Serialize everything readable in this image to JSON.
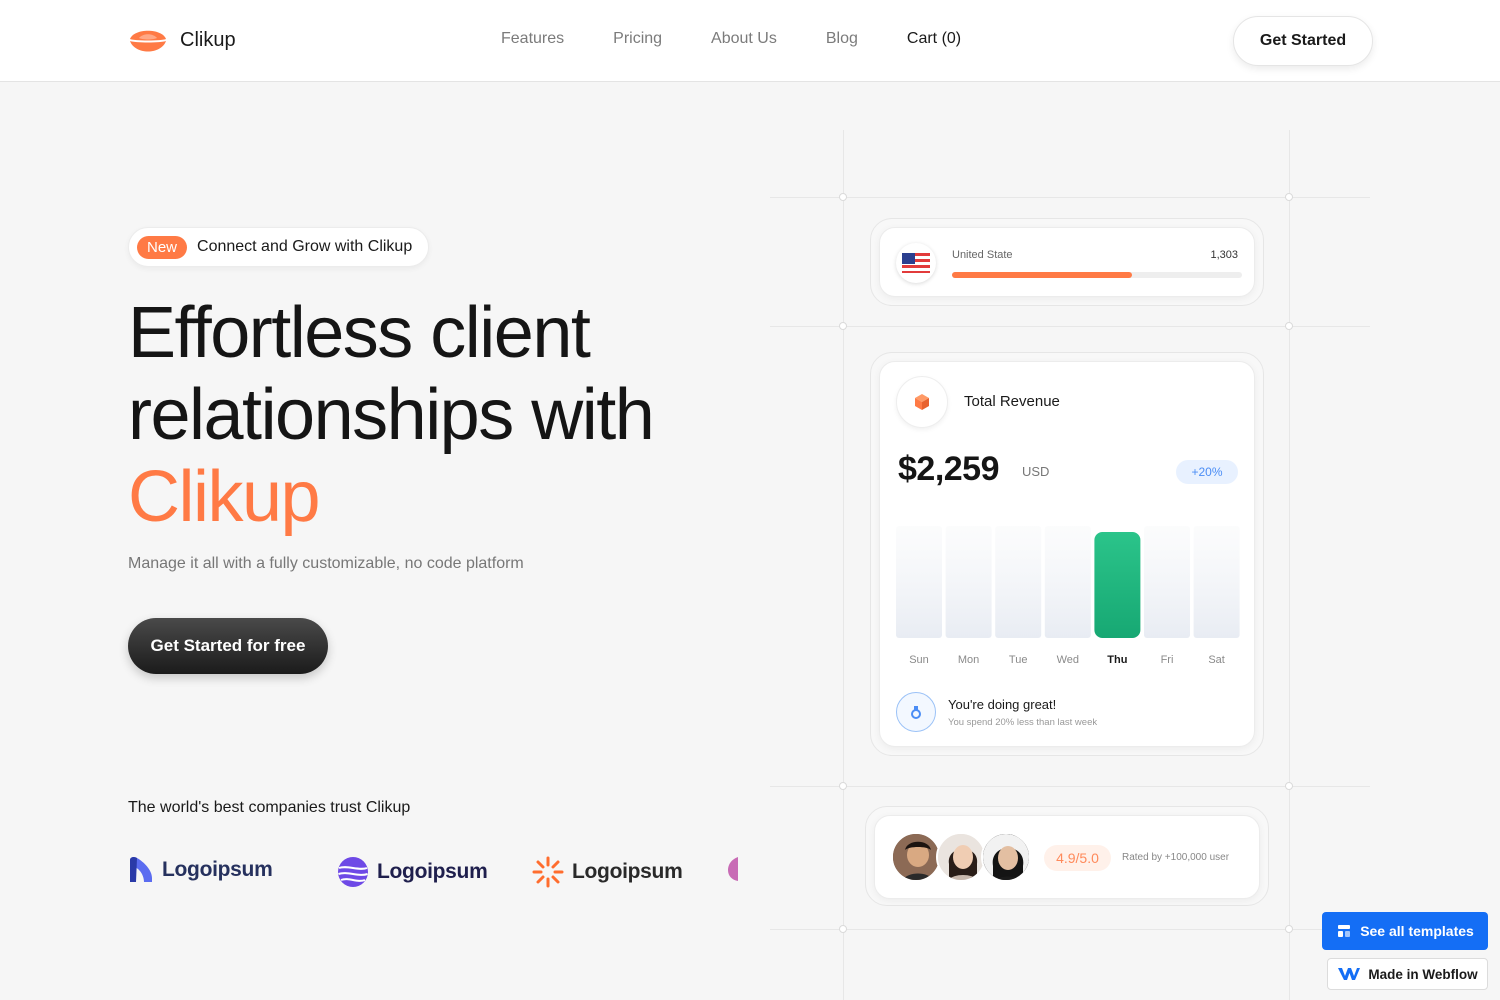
{
  "nav": {
    "brand": "Clikup",
    "links": [
      "Features",
      "Pricing",
      "About Us",
      "Blog"
    ],
    "cart": "Cart (0)",
    "cta": "Get Started",
    "colors": {
      "accent": "#ff7a45"
    }
  },
  "hero": {
    "badge_new": "New",
    "badge_text": "Connect and Grow with Clikup",
    "title_line1": "Effortless client",
    "title_line2": "relationships with",
    "title_accent": "Clikup",
    "subtitle": "Manage it all with a fully customizable, no code platform",
    "cta": "Get Started for free",
    "trust_text": "The world's best companies trust Clikup",
    "logos": [
      "Logoipsum",
      "Logoipsum",
      "Logoipsum"
    ]
  },
  "country_card": {
    "country": "United State",
    "value": "1,303",
    "progress": 0.62,
    "flag_icon": "us-flag-icon"
  },
  "revenue_card": {
    "title": "Total Revenue",
    "amount": "$2,259",
    "currency": "USD",
    "change": "+20%",
    "days": [
      "Sun",
      "Mon",
      "Tue",
      "Wed",
      "Thu",
      "Fri",
      "Sat"
    ],
    "active_day": "Thu",
    "status_title": "You're doing great!",
    "status_sub": "You spend 20% less than last week"
  },
  "rating_card": {
    "rating": "4.9/5.0",
    "rated_by": "Rated by +100,000 user"
  },
  "webflow": {
    "templates": "See all templates",
    "made": "Made in Webflow",
    "color": "#146ef5"
  }
}
